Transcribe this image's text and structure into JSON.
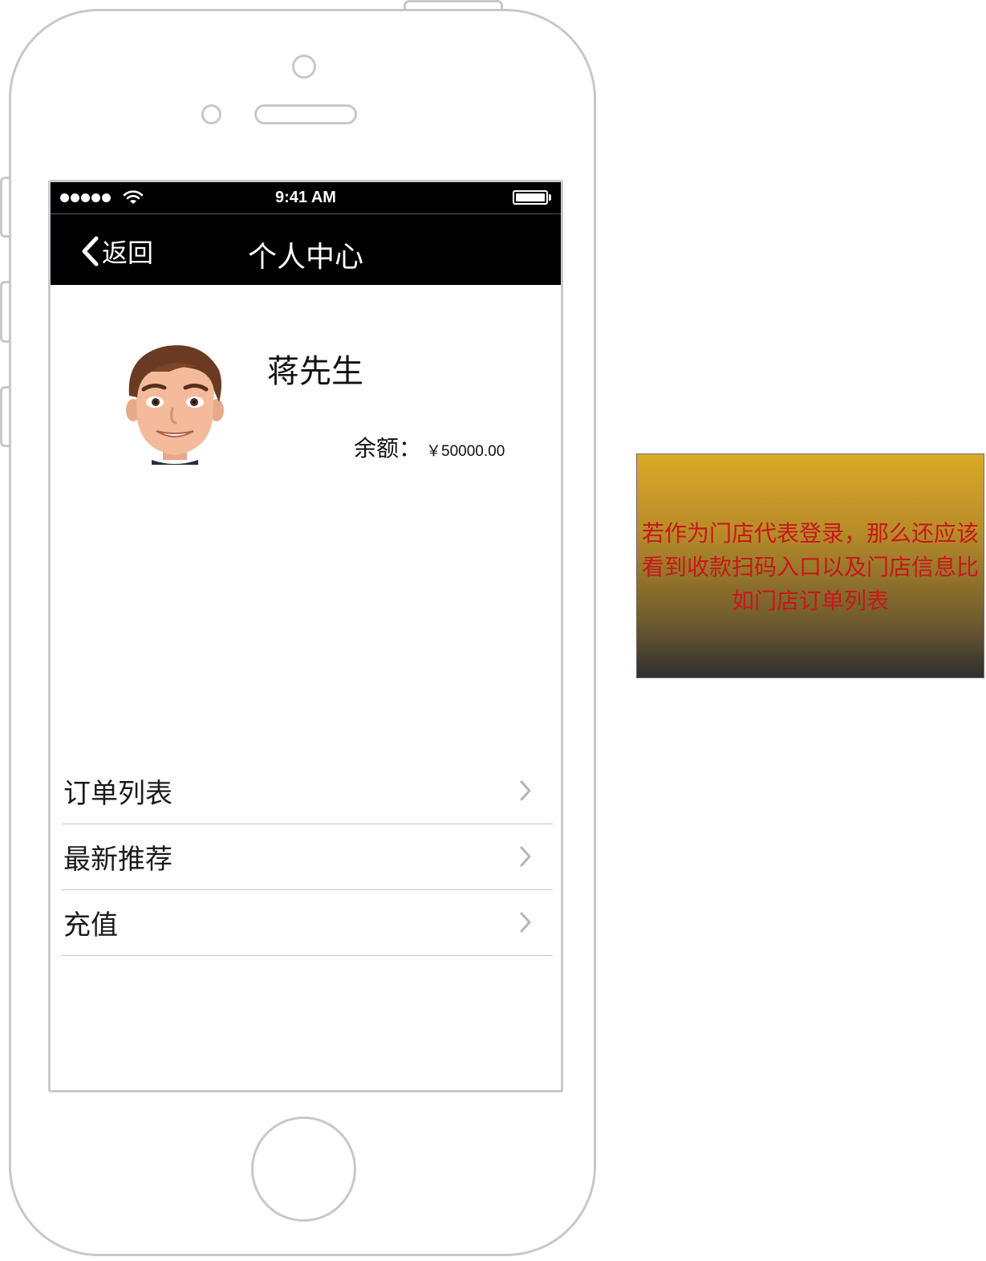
{
  "status_bar": {
    "time": "9:41 AM",
    "signal_dots": 5
  },
  "nav": {
    "back_label": "返回",
    "title": "个人中心"
  },
  "profile": {
    "name": "蒋先生",
    "balance_label": "余额：",
    "balance_value": "￥50000.00"
  },
  "menu": {
    "items": [
      {
        "label": "订单列表"
      },
      {
        "label": "最新推荐"
      },
      {
        "label": "充值"
      }
    ]
  },
  "note": {
    "text": "若作为门店代表登录，那么还应该看到收款扫码入口以及门店信息比如门店订单列表"
  },
  "colors": {
    "note_text": "#c9161b",
    "note_gradient_top": "#dba927",
    "note_gradient_bottom": "#2f2f30",
    "phone_outline": "#c8c8cc",
    "bar_background": "#000000"
  }
}
